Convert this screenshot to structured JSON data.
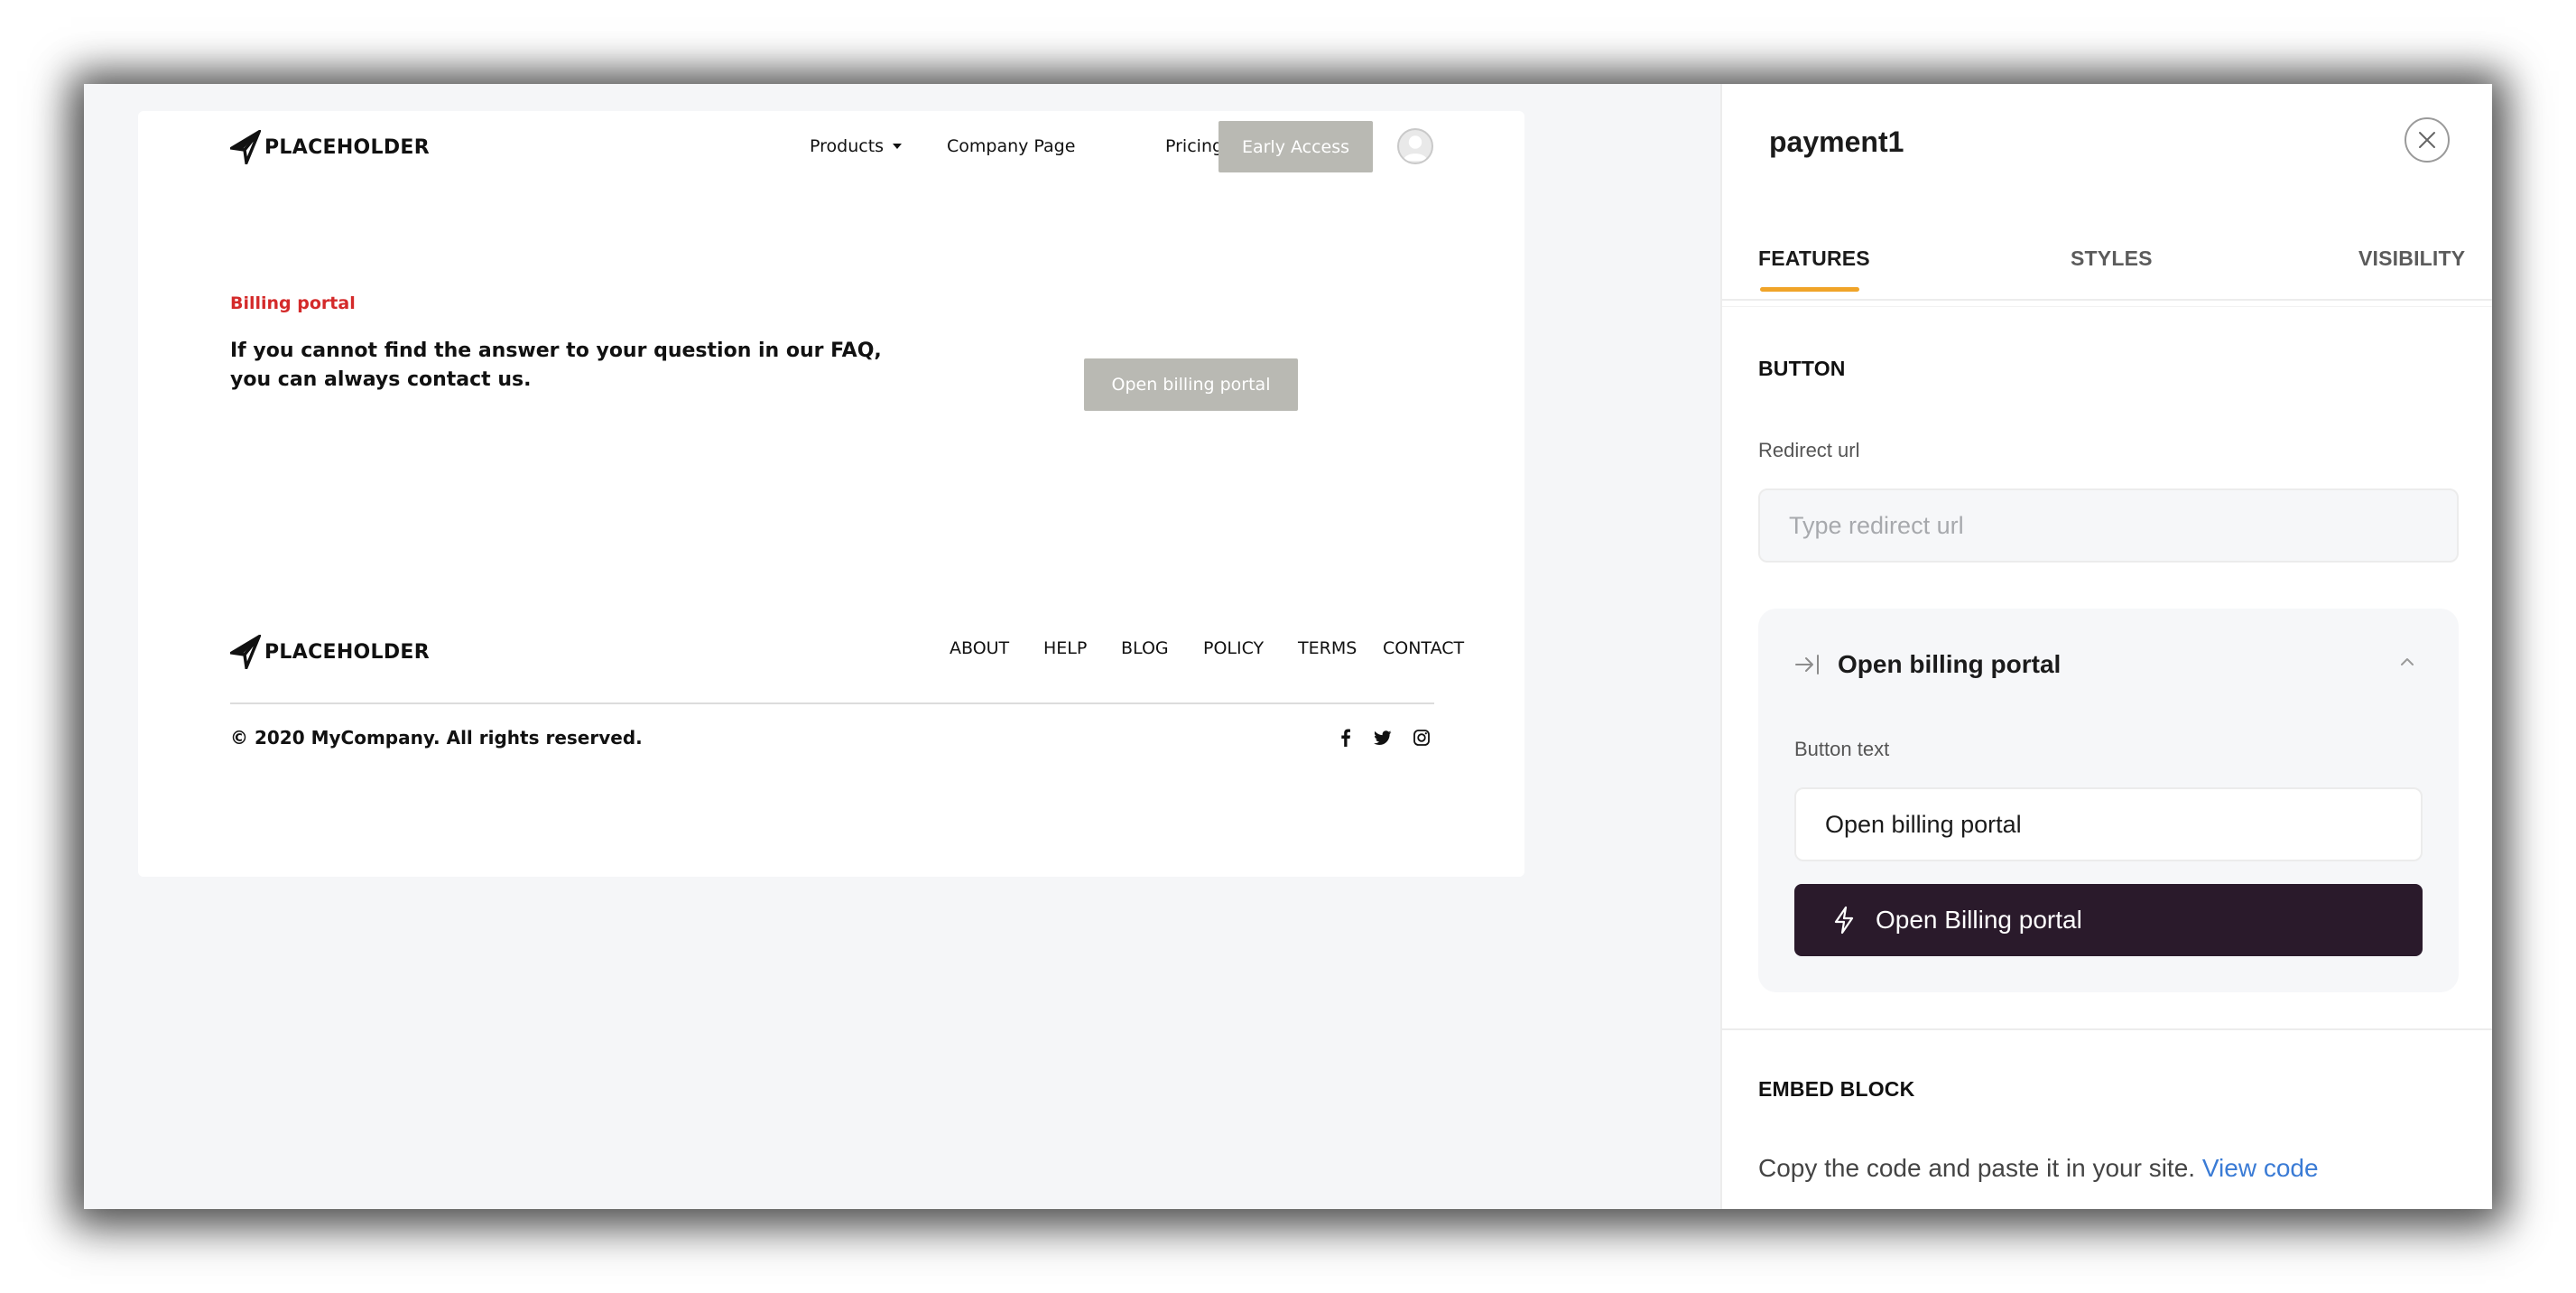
{
  "preview": {
    "logo_text": "PLACEHOLDER",
    "nav": {
      "products": "Products",
      "company": "Company Page",
      "pricing": "Pricing",
      "early_access": "Early Access"
    },
    "billing": {
      "eyebrow": "Billing portal",
      "text": "If you cannot find the answer to your question in our FAQ, you can always contact us.",
      "button": "Open billing portal"
    },
    "footer": {
      "logo_text": "PLACEHOLDER",
      "links": [
        "ABOUT",
        "HELP",
        "BLOG",
        "POLICY",
        "TERMS",
        "CONTACT"
      ],
      "copyright": "© 2020 MyCompany. All rights reserved.",
      "social_icons": [
        "facebook-icon",
        "twitter-icon",
        "instagram-icon"
      ]
    }
  },
  "panel": {
    "title": "payment1",
    "tabs": [
      {
        "label": "FEATURES",
        "active": true
      },
      {
        "label": "STYLES",
        "active": false
      },
      {
        "label": "VISIBILITY",
        "active": false
      }
    ],
    "button_section": {
      "heading": "BUTTON",
      "redirect_label": "Redirect url",
      "redirect_placeholder": "Type redirect url",
      "card_title": "Open billing portal",
      "button_text_label": "Button text",
      "button_text_value": "Open billing portal",
      "action_button": "Open Billing portal"
    },
    "embed_section": {
      "heading": "EMBED BLOCK",
      "text": "Copy the code and paste it in your site.",
      "link": "View code"
    }
  },
  "colors": {
    "accent_tab": "#f0a428",
    "eyebrow_red": "#d42a2a",
    "action_button_bg": "#2a1a2b",
    "link_blue": "#3a7bd5",
    "preview_button_gray": "#b9b9b3"
  }
}
